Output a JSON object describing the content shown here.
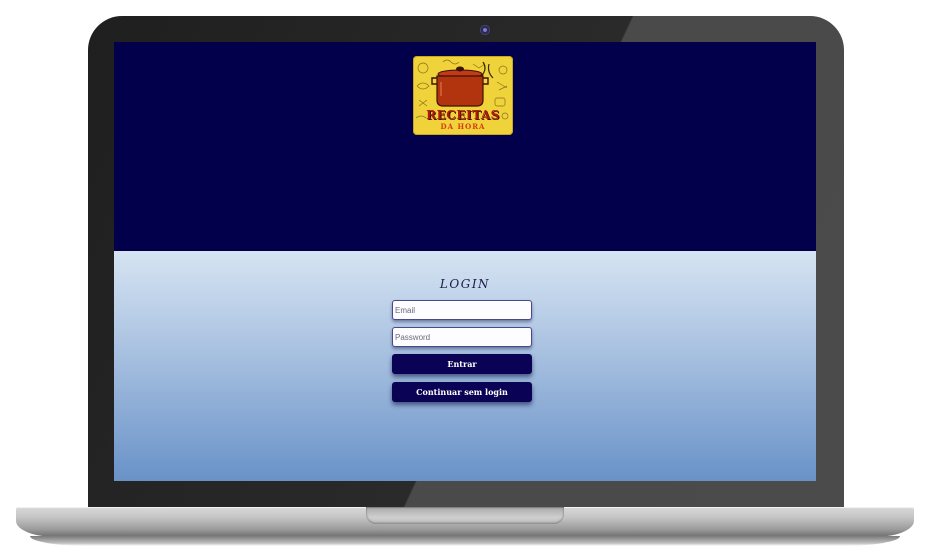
{
  "logo": {
    "line1": "RECEITAS",
    "line2": "DA HORA",
    "icon": "cooking-pot-icon"
  },
  "login": {
    "title": "LOGIN",
    "email_placeholder": "Email",
    "email_value": "",
    "password_placeholder": "Password",
    "password_value": "",
    "enter_label": "Entrar",
    "guest_label": "Continuar sem login"
  },
  "colors": {
    "header_background": "#02004a",
    "login_gradient_top": "#d6e4f2",
    "login_gradient_bottom": "#6992c8",
    "button_background": "#0a0355",
    "logo_background": "#f0d23a",
    "logo_text": "#b01a10"
  }
}
